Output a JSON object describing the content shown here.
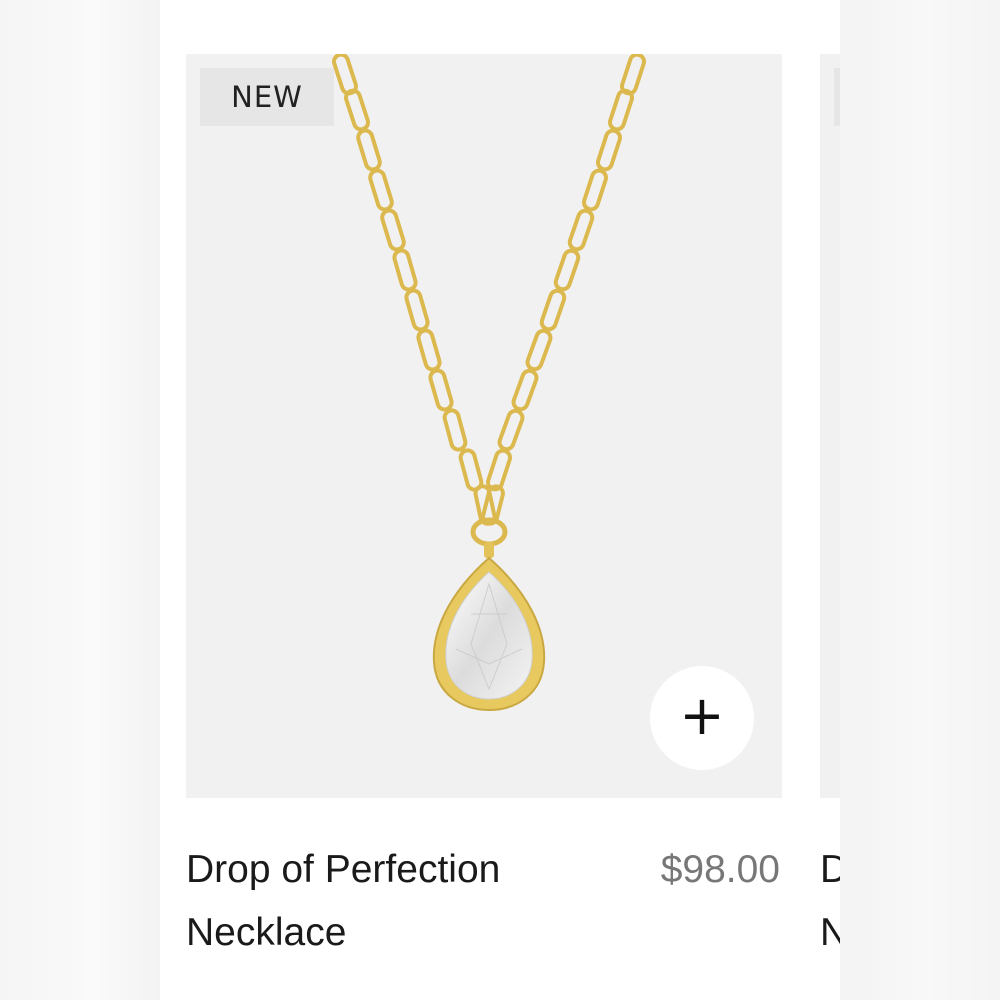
{
  "product": {
    "badge": "NEW",
    "name": "Drop of Perfection Necklace",
    "price": "$98.00",
    "add_icon": "plus-icon",
    "add_symbol": "+"
  },
  "next_product": {
    "badge": "",
    "name_line1": "D",
    "name_line2": "N"
  },
  "colors": {
    "gold": "#e3c25a",
    "image_bg": "#f1f1f1",
    "badge_bg": "#e6e6e6",
    "price": "#777777"
  }
}
